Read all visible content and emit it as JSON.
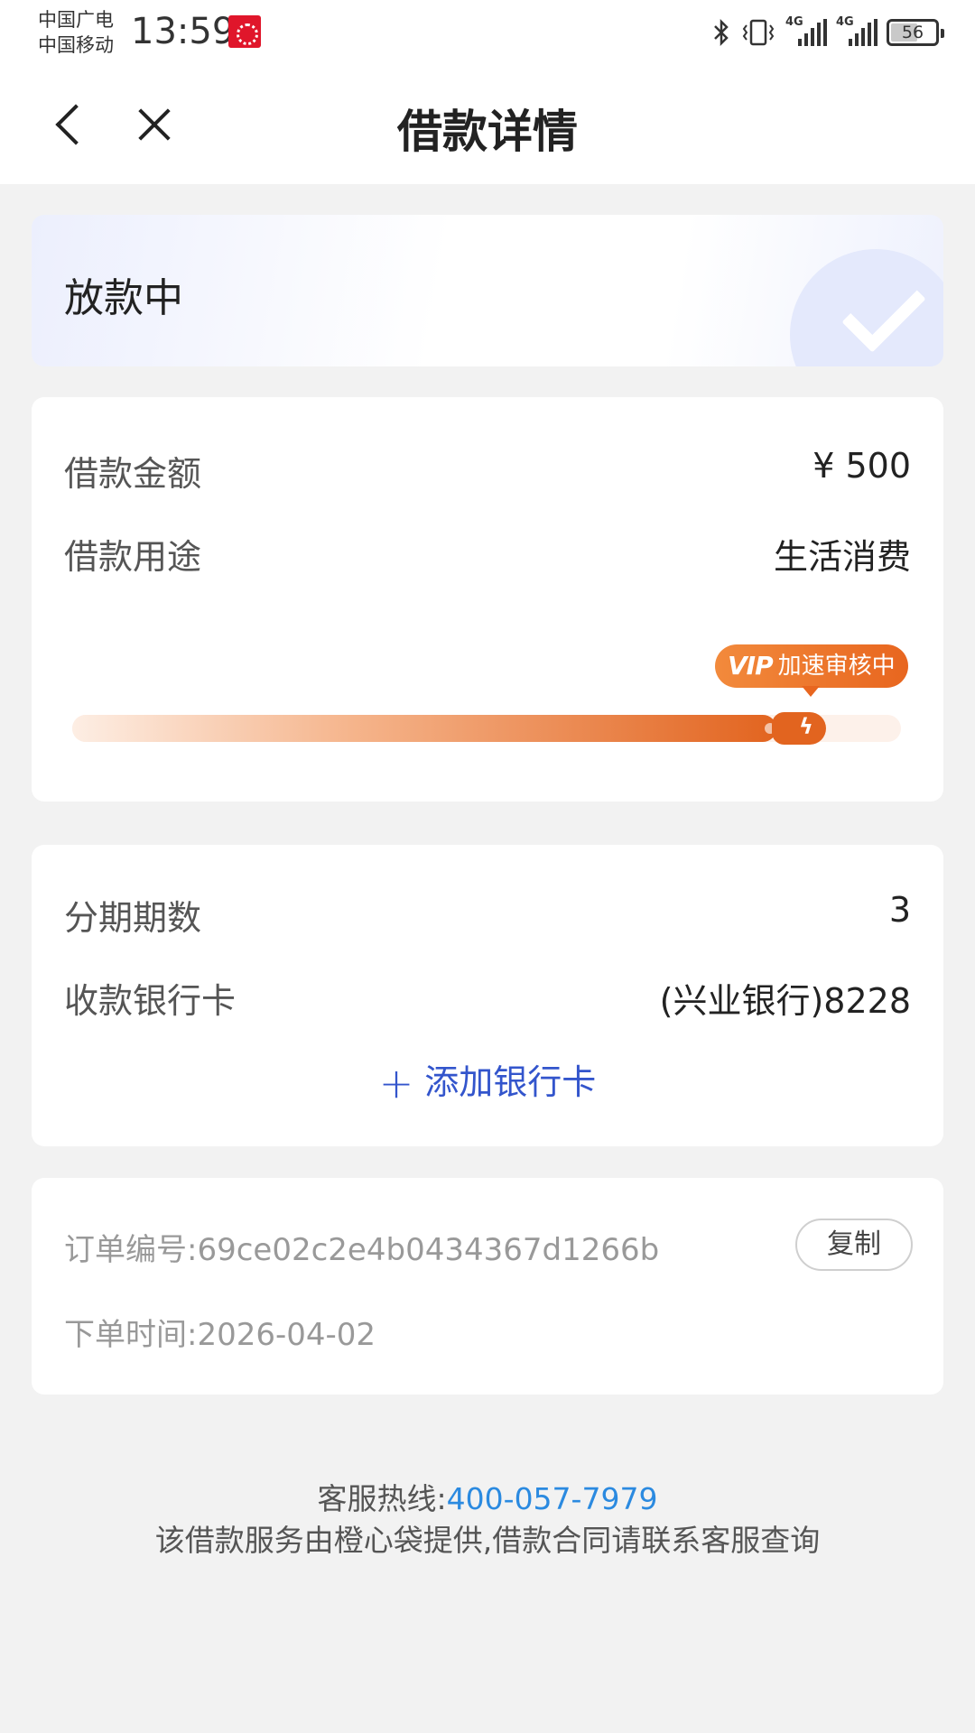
{
  "status_bar": {
    "carrier1": "中国广电",
    "carrier2": "中国移动",
    "time": "13:59",
    "net1": "4G",
    "net2": "4G",
    "battery": "56"
  },
  "header": {
    "title": "借款详情"
  },
  "status_card": {
    "status": "放款中"
  },
  "loan": {
    "amount_label": "借款金额",
    "amount_value": "¥ 500",
    "purpose_label": "借款用途",
    "purpose_value": "生活消费",
    "vip_tag": "VIP",
    "badge_text": "加速审核中",
    "progress_percent": 85
  },
  "installment": {
    "periods_label": "分期期数",
    "periods_value": "3",
    "card_label": "收款银行卡",
    "card_value": "(兴业银行)8228",
    "add_card": "添加银行卡"
  },
  "order": {
    "number_label": "订单编号:",
    "number_value": "69ce02c2e4b0434367d1266b",
    "copy_label": "复制",
    "time_label": "下单时间:",
    "time_value": "2026-04-02"
  },
  "footer": {
    "hotline_label": "客服热线:",
    "hotline_number": "400-057-7979",
    "disclaimer": "该借款服务由橙心袋提供,借款合同请联系客服查询"
  }
}
